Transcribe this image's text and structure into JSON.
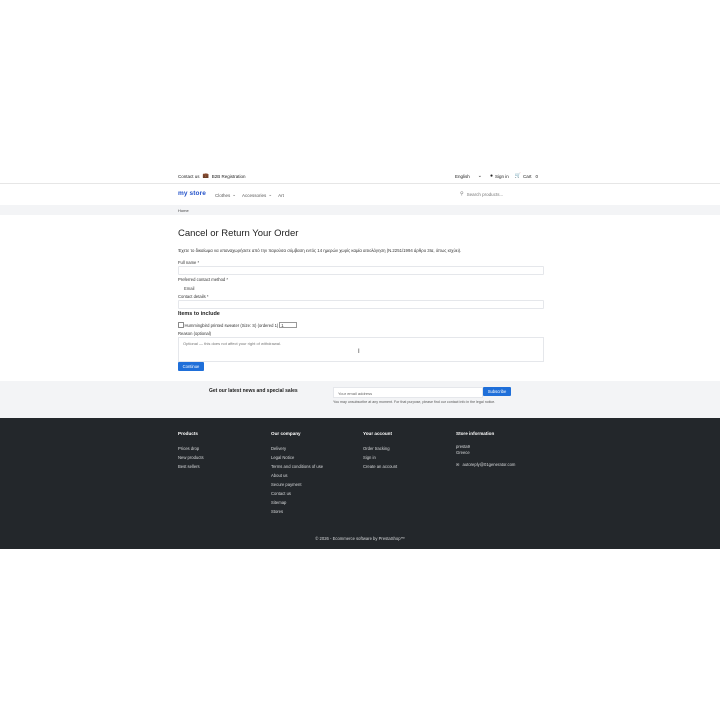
{
  "topbar": {
    "contact": "Contact us",
    "b2b": "B2B Registration",
    "language": "English",
    "signin": "Sign in",
    "cart": "Cart",
    "cart_count": "0"
  },
  "header": {
    "logo_my": "my",
    "logo_store": "store",
    "nav": [
      "Clothes",
      "Accessories",
      "Art"
    ],
    "search_placeholder": "Search products..."
  },
  "breadcrumb": {
    "home": "Home"
  },
  "form": {
    "title": "Cancel or Return Your Order",
    "notice": "Έχετε το δικαίωμα να υπαναχωρήσετε από την παρούσα σύμβαση εντός 14 ημερών χωρίς καμία αιτιολόγηση (Ν.2251/1994 άρθρο 3Ια, όπως ισχύει).",
    "full_name_label": "Full name *",
    "contact_method_label": "Preferred contact method *",
    "contact_method_value": "Email",
    "contact_details_label": "Contact details *",
    "items_heading": "Items to include",
    "item_label": "Hummingbird printed sweater (Size: S) (ordered 1)",
    "item_qty": "1",
    "reason_label": "Reason (optional)",
    "reason_placeholder": "Optional — this does not affect your right of withdrawal.",
    "continue": "Continue"
  },
  "newsletter": {
    "title": "Get our latest news and special sales",
    "placeholder": "Your email address",
    "subscribe": "Subscribe",
    "fine_print": "You may unsubscribe at any moment. For that purpose, please find our contact info in the legal notice."
  },
  "footer": {
    "products": {
      "heading": "Products",
      "links": [
        "Prices drop",
        "New products",
        "Best sellers"
      ]
    },
    "company": {
      "heading": "Our company",
      "links": [
        "Delivery",
        "Legal Notice",
        "Terms and conditions of use",
        "About us",
        "Secure payment",
        "Contact us",
        "Sitemap",
        "Stores"
      ]
    },
    "account": {
      "heading": "Your account",
      "links": [
        "Order tracking",
        "Sign in",
        "Create an account"
      ]
    },
    "store": {
      "heading": "Store information",
      "name": "presta9",
      "country": "Greece",
      "email": "autoreply@01generator.com"
    },
    "copyright": "© 2026 - Ecommerce software by PrestaShop™"
  },
  "colors": {
    "accent": "#1f6fd9",
    "footer_bg": "#23272b",
    "logo": "#2251c9"
  }
}
